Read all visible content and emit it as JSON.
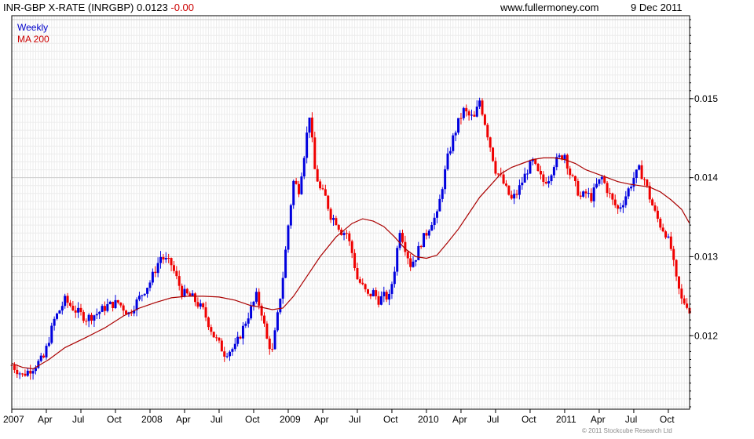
{
  "header": {
    "title": "INR-GBP X-RATE (INRGBP)",
    "last": "0.0123",
    "change": "-0.00",
    "site": "www.fullermoney.com",
    "date": "9 Dec 2011"
  },
  "copyright": "© 2011 Stockcube Research Ltd",
  "colors": {
    "up": "#0000dd",
    "down": "#ee0000",
    "ma": "#aa0000",
    "grid": "#cccccc",
    "border": "#000000"
  },
  "chart_data": {
    "type": "bar",
    "style": "weekly OHLC bars, blue = up week, red = down week",
    "grid": true,
    "legend_position": "top-left",
    "xlim": [
      0,
      255
    ],
    "ylim": [
      0.01107,
      0.01605
    ],
    "y_ticks": [
      "0.012",
      "0.013",
      "0.014",
      "0.015"
    ],
    "x_ticks": [
      {
        "label": "2007",
        "week": 0
      },
      {
        "label": "Apr",
        "week": 13
      },
      {
        "label": "Jul",
        "week": 26
      },
      {
        "label": "Oct",
        "week": 39
      },
      {
        "label": "2008",
        "week": 52
      },
      {
        "label": "Apr",
        "week": 65
      },
      {
        "label": "Jul",
        "week": 78
      },
      {
        "label": "Oct",
        "week": 91
      },
      {
        "label": "2009",
        "week": 104
      },
      {
        "label": "Apr",
        "week": 117
      },
      {
        "label": "Jul",
        "week": 130
      },
      {
        "label": "Oct",
        "week": 143
      },
      {
        "label": "2010",
        "week": 156
      },
      {
        "label": "Apr",
        "week": 169
      },
      {
        "label": "Jul",
        "week": 182
      },
      {
        "label": "Oct",
        "week": 195
      },
      {
        "label": "2011",
        "week": 208
      },
      {
        "label": "Apr",
        "week": 221
      },
      {
        "label": "Jul",
        "week": 234
      },
      {
        "label": "Oct",
        "week": 247
      }
    ],
    "series": [
      {
        "name": "Weekly",
        "color": "#0000cc",
        "close_anchors": [
          [
            0,
            0.01163
          ],
          [
            4,
            0.0115
          ],
          [
            8,
            0.0116
          ],
          [
            12,
            0.01172
          ],
          [
            16,
            0.0122
          ],
          [
            20,
            0.01245
          ],
          [
            24,
            0.01232
          ],
          [
            28,
            0.01222
          ],
          [
            32,
            0.01228
          ],
          [
            36,
            0.01238
          ],
          [
            40,
            0.01242
          ],
          [
            44,
            0.01228
          ],
          [
            48,
            0.01248
          ],
          [
            52,
            0.01268
          ],
          [
            56,
            0.013
          ],
          [
            60,
            0.0129
          ],
          [
            64,
            0.01255
          ],
          [
            68,
            0.01248
          ],
          [
            72,
            0.01232
          ],
          [
            76,
            0.012
          ],
          [
            80,
            0.01178
          ],
          [
            84,
            0.01185
          ],
          [
            88,
            0.01218
          ],
          [
            92,
            0.0125
          ],
          [
            94,
            0.0123
          ],
          [
            96,
            0.01195
          ],
          [
            98,
            0.0118
          ],
          [
            100,
            0.01225
          ],
          [
            102,
            0.01275
          ],
          [
            104,
            0.0134
          ],
          [
            106,
            0.01395
          ],
          [
            108,
            0.01385
          ],
          [
            110,
            0.0143
          ],
          [
            112,
            0.0148
          ],
          [
            114,
            0.0141
          ],
          [
            116,
            0.01385
          ],
          [
            118,
            0.01375
          ],
          [
            120,
            0.01352
          ],
          [
            122,
            0.01345
          ],
          [
            124,
            0.01332
          ],
          [
            126,
            0.0133
          ],
          [
            128,
            0.01305
          ],
          [
            130,
            0.01272
          ],
          [
            132,
            0.01262
          ],
          [
            134,
            0.0125
          ],
          [
            136,
            0.01255
          ],
          [
            138,
            0.01245
          ],
          [
            140,
            0.0125
          ],
          [
            142,
            0.01248
          ],
          [
            144,
            0.01285
          ],
          [
            146,
            0.01335
          ],
          [
            148,
            0.01312
          ],
          [
            150,
            0.0129
          ],
          [
            152,
            0.013
          ],
          [
            154,
            0.01318
          ],
          [
            156,
            0.0133
          ],
          [
            158,
            0.01345
          ],
          [
            160,
            0.01352
          ],
          [
            162,
            0.0139
          ],
          [
            164,
            0.01425
          ],
          [
            166,
            0.0145
          ],
          [
            168,
            0.0147
          ],
          [
            170,
            0.01485
          ],
          [
            172,
            0.01478
          ],
          [
            174,
            0.01475
          ],
          [
            176,
            0.01498
          ],
          [
            178,
            0.0147
          ],
          [
            180,
            0.0144
          ],
          [
            182,
            0.0141
          ],
          [
            184,
            0.014
          ],
          [
            186,
            0.01385
          ],
          [
            188,
            0.01372
          ],
          [
            190,
            0.0138
          ],
          [
            192,
            0.01395
          ],
          [
            194,
            0.0141
          ],
          [
            196,
            0.0142
          ],
          [
            198,
            0.01405
          ],
          [
            200,
            0.01395
          ],
          [
            202,
            0.014
          ],
          [
            204,
            0.01418
          ],
          [
            206,
            0.01425
          ],
          [
            208,
            0.0143
          ],
          [
            210,
            0.01405
          ],
          [
            212,
            0.0139
          ],
          [
            214,
            0.01375
          ],
          [
            216,
            0.0138
          ],
          [
            218,
            0.01375
          ],
          [
            220,
            0.0139
          ],
          [
            222,
            0.014
          ],
          [
            224,
            0.01385
          ],
          [
            226,
            0.0137
          ],
          [
            228,
            0.0136
          ],
          [
            230,
            0.0137
          ],
          [
            232,
            0.01385
          ],
          [
            234,
            0.014
          ],
          [
            236,
            0.0141
          ],
          [
            238,
            0.01398
          ],
          [
            240,
            0.01375
          ],
          [
            242,
            0.01355
          ],
          [
            244,
            0.0134
          ],
          [
            246,
            0.0133
          ],
          [
            248,
            0.0131
          ],
          [
            250,
            0.0127
          ],
          [
            252,
            0.01245
          ],
          [
            254,
            0.0124
          ],
          [
            255,
            0.0123
          ]
        ]
      },
      {
        "name": "MA 200",
        "color": "#cc0000",
        "points": [
          [
            0,
            0.01165
          ],
          [
            4,
            0.0116
          ],
          [
            8,
            0.01158
          ],
          [
            14,
            0.0117
          ],
          [
            20,
            0.01185
          ],
          [
            28,
            0.01198
          ],
          [
            35,
            0.0121
          ],
          [
            42,
            0.01225
          ],
          [
            48,
            0.01235
          ],
          [
            54,
            0.01242
          ],
          [
            60,
            0.01248
          ],
          [
            66,
            0.0125
          ],
          [
            72,
            0.0125
          ],
          [
            78,
            0.01249
          ],
          [
            84,
            0.01245
          ],
          [
            90,
            0.01238
          ],
          [
            94,
            0.01236
          ],
          [
            98,
            0.01233
          ],
          [
            102,
            0.01235
          ],
          [
            106,
            0.0125
          ],
          [
            110,
            0.0127
          ],
          [
            116,
            0.013
          ],
          [
            122,
            0.01325
          ],
          [
            128,
            0.01342
          ],
          [
            132,
            0.01348
          ],
          [
            136,
            0.01345
          ],
          [
            140,
            0.01338
          ],
          [
            144,
            0.01325
          ],
          [
            148,
            0.0131
          ],
          [
            152,
            0.013
          ],
          [
            156,
            0.01298
          ],
          [
            160,
            0.01302
          ],
          [
            164,
            0.01318
          ],
          [
            168,
            0.01335
          ],
          [
            172,
            0.01355
          ],
          [
            176,
            0.01375
          ],
          [
            180,
            0.0139
          ],
          [
            184,
            0.01405
          ],
          [
            188,
            0.01413
          ],
          [
            192,
            0.01418
          ],
          [
            196,
            0.01423
          ],
          [
            200,
            0.01425
          ],
          [
            204,
            0.01425
          ],
          [
            208,
            0.01423
          ],
          [
            212,
            0.01418
          ],
          [
            216,
            0.0141
          ],
          [
            220,
            0.01405
          ],
          [
            224,
            0.014
          ],
          [
            228,
            0.01395
          ],
          [
            232,
            0.01392
          ],
          [
            236,
            0.0139
          ],
          [
            240,
            0.01388
          ],
          [
            244,
            0.01382
          ],
          [
            248,
            0.01372
          ],
          [
            252,
            0.0136
          ],
          [
            255,
            0.01342
          ]
        ]
      }
    ]
  }
}
